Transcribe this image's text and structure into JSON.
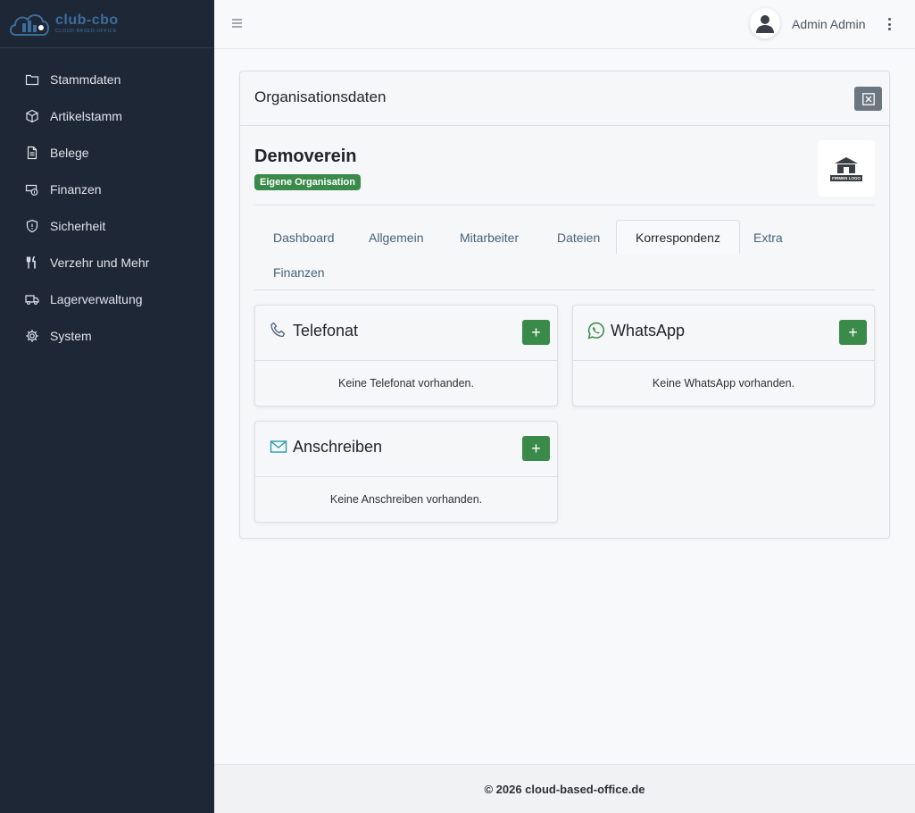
{
  "brand": {
    "name": "club-cbo",
    "subtitle": "CLOUD-BASED-OFFICE"
  },
  "sidebar": {
    "items": [
      {
        "label": "Stammdaten",
        "icon": "folder-icon"
      },
      {
        "label": "Artikelstamm",
        "icon": "box-icon"
      },
      {
        "label": "Belege",
        "icon": "document-icon"
      },
      {
        "label": "Finanzen",
        "icon": "money-icon"
      },
      {
        "label": "Sicherheit",
        "icon": "shield-icon"
      },
      {
        "label": "Verzehr und Mehr",
        "icon": "cutlery-icon"
      },
      {
        "label": "Lagerverwaltung",
        "icon": "truck-icon"
      },
      {
        "label": "System",
        "icon": "gear-icon"
      }
    ]
  },
  "topbar": {
    "user_name": "Admin Admin"
  },
  "card": {
    "title": "Organisationsdaten",
    "org_name": "Demoverein",
    "badge": "Eigene Organisation",
    "logo_text": "FIRMEN LOGO"
  },
  "tabs": [
    {
      "label": "Dashboard",
      "active": false
    },
    {
      "label": "Allgemein",
      "active": false
    },
    {
      "label": "Mitarbeiter",
      "active": false
    },
    {
      "label": "Dateien",
      "active": false
    },
    {
      "label": "Korrespondenz",
      "active": true
    },
    {
      "label": "Extra",
      "active": false
    },
    {
      "label": "Finanzen",
      "active": false
    }
  ],
  "correspondence": {
    "phone": {
      "title": "Telefonat",
      "empty": "Keine Telefonat vorhanden.",
      "icon": "phone-icon"
    },
    "whatsapp": {
      "title": "WhatsApp",
      "empty": "Keine WhatsApp vorhanden.",
      "icon": "whatsapp-icon"
    },
    "letter": {
      "title": "Anschreiben",
      "empty": "Keine Anschreiben vorhanden.",
      "icon": "envelope-icon"
    },
    "add_label": "+"
  },
  "footer": {
    "text": "© 2026 cloud-based-office.de"
  },
  "colors": {
    "sidebar": "#1e2736",
    "accent_green": "#3a8a4a",
    "link_blue": "#4a6178",
    "icon_teal": "#2a9aa8"
  }
}
